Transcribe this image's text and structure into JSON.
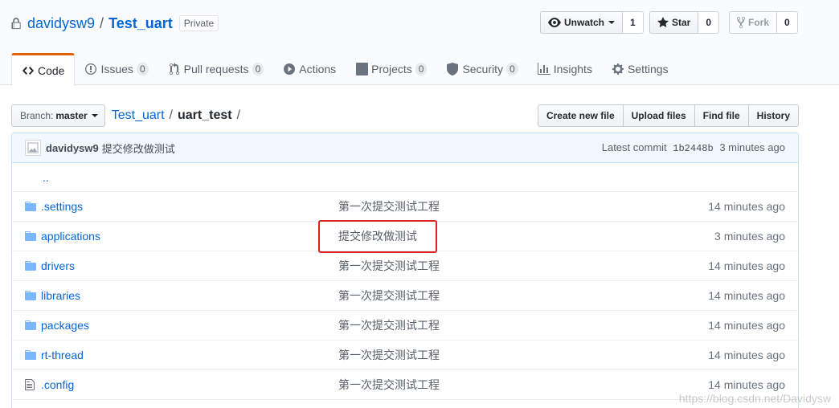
{
  "repo": {
    "owner": "davidysw9",
    "separator": "/",
    "name": "Test_uart",
    "visibility": "Private"
  },
  "actions": {
    "watch_label": "Unwatch",
    "watch_count": "1",
    "star_label": "Star",
    "star_count": "0",
    "fork_label": "Fork",
    "fork_count": "0"
  },
  "tabs": [
    {
      "label": "Code",
      "icon": "code-icon"
    },
    {
      "label": "Issues",
      "count": "0",
      "icon": "issue-icon"
    },
    {
      "label": "Pull requests",
      "count": "0",
      "icon": "pull-request-icon"
    },
    {
      "label": "Actions",
      "icon": "play-icon"
    },
    {
      "label": "Projects",
      "count": "0",
      "icon": "project-icon"
    },
    {
      "label": "Security",
      "count": "0",
      "icon": "shield-icon"
    },
    {
      "label": "Insights",
      "icon": "graph-icon"
    },
    {
      "label": "Settings",
      "icon": "gear-icon"
    }
  ],
  "filenav": {
    "branch_label": "Branch:",
    "branch_value": "master",
    "crumb_root": "Test_uart",
    "crumb_current": "uart_test",
    "sep": "/",
    "buttons": [
      "Create new file",
      "Upload files",
      "Find file",
      "History"
    ]
  },
  "commit": {
    "author": "davidysw9",
    "message": "提交修改做测试",
    "latest_label": "Latest commit",
    "sha": "1b2448b",
    "age": "3 minutes ago"
  },
  "parent_dir": "..",
  "files": [
    {
      "name": ".settings",
      "type": "dir",
      "message": "第一次提交测试工程",
      "age": "14 minutes ago"
    },
    {
      "name": "applications",
      "type": "dir",
      "message": "提交修改做测试",
      "age": "3 minutes ago"
    },
    {
      "name": "drivers",
      "type": "dir",
      "message": "第一次提交测试工程",
      "age": "14 minutes ago"
    },
    {
      "name": "libraries",
      "type": "dir",
      "message": "第一次提交测试工程",
      "age": "14 minutes ago"
    },
    {
      "name": "packages",
      "type": "dir",
      "message": "第一次提交测试工程",
      "age": "14 minutes ago"
    },
    {
      "name": "rt-thread",
      "type": "dir",
      "message": "第一次提交测试工程",
      "age": "14 minutes ago"
    },
    {
      "name": ".config",
      "type": "file",
      "message": "第一次提交测试工程",
      "age": "14 minutes ago"
    }
  ],
  "watermark": "https://blog.csdn.net/Davidysw",
  "colors": {
    "link": "#0366d6",
    "tab_accent": "#e36209",
    "highlight": "#e0201e",
    "folder": "#79b8ff"
  }
}
